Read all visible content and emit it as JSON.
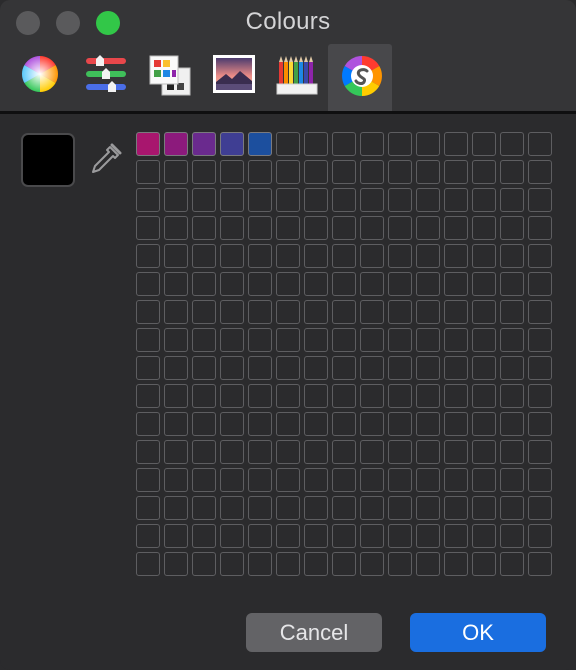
{
  "window": {
    "title": "Colours"
  },
  "toolbar": {
    "tools": [
      {
        "name": "colour-wheel",
        "icon": "colour-wheel-icon"
      },
      {
        "name": "colour-sliders",
        "icon": "colour-sliders-icon"
      },
      {
        "name": "colour-palettes",
        "icon": "colour-palettes-icon"
      },
      {
        "name": "image-palettes",
        "icon": "image-palettes-icon"
      },
      {
        "name": "pencils",
        "icon": "pencils-icon"
      },
      {
        "name": "custom-palette",
        "icon": "custom-palette-icon",
        "selected": true
      }
    ]
  },
  "current_colour": "#000000",
  "swatch_grid": {
    "columns": 15,
    "rows": 16,
    "filled": [
      "#a8166e",
      "#8c1a7c",
      "#6a2a8e",
      "#3f3e93",
      "#1c4f9e"
    ],
    "empty_color": "#2b2b2d",
    "border_color": "#5e5e61"
  },
  "buttons": {
    "cancel": "Cancel",
    "ok": "OK"
  },
  "colors": {
    "accent": "#1a6ee0",
    "zoom": "#32c748",
    "background": "#2b2b2d"
  }
}
